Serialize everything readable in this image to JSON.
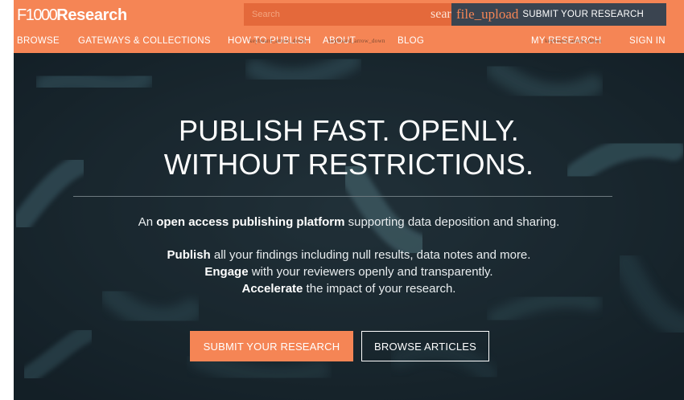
{
  "brand": {
    "logo_light": "F1000",
    "logo_bold": "Research",
    "accent_color": "#f58555",
    "dark_color": "#3a4450"
  },
  "search": {
    "placeholder": "Search",
    "icon_text": "search",
    "icon": "search-icon"
  },
  "submit_top": {
    "icon_text": "file_upload",
    "icon": "file-upload-icon",
    "label": "SUBMIT YOUR RESEARCH"
  },
  "nav": {
    "browse": "BROWSE",
    "gateways": "GATEWAYS & COLLECTIONS",
    "how_to_publish": "HOW TO PUBLISH",
    "how_overlay": "keyboard_arrow_down",
    "about": "ABOUT",
    "about_overlay": "keyboard_arrow_down",
    "blog": "BLOG",
    "my_research": "MY RESEARCH",
    "my_research_overlay": "keyboard_arrow_down",
    "sign_in": "SIGN IN"
  },
  "hero": {
    "headline_line1": "PUBLISH FAST. OPENLY.",
    "headline_line2": "WITHOUT RESTRICTIONS.",
    "tagline_pre": "An ",
    "tagline_bold": "open access publishing platform",
    "tagline_post": " supporting data deposition and sharing.",
    "bullets": [
      {
        "bold": "Publish",
        "text": " all your findings including null results, data notes and more."
      },
      {
        "bold": "Engage",
        "text": " with your reviewers openly and transparently."
      },
      {
        "bold": "Accelerate",
        "text": " the impact of your research."
      }
    ],
    "primary_button": "SUBMIT YOUR RESEARCH",
    "secondary_button": "BROWSE ARTICLES"
  }
}
